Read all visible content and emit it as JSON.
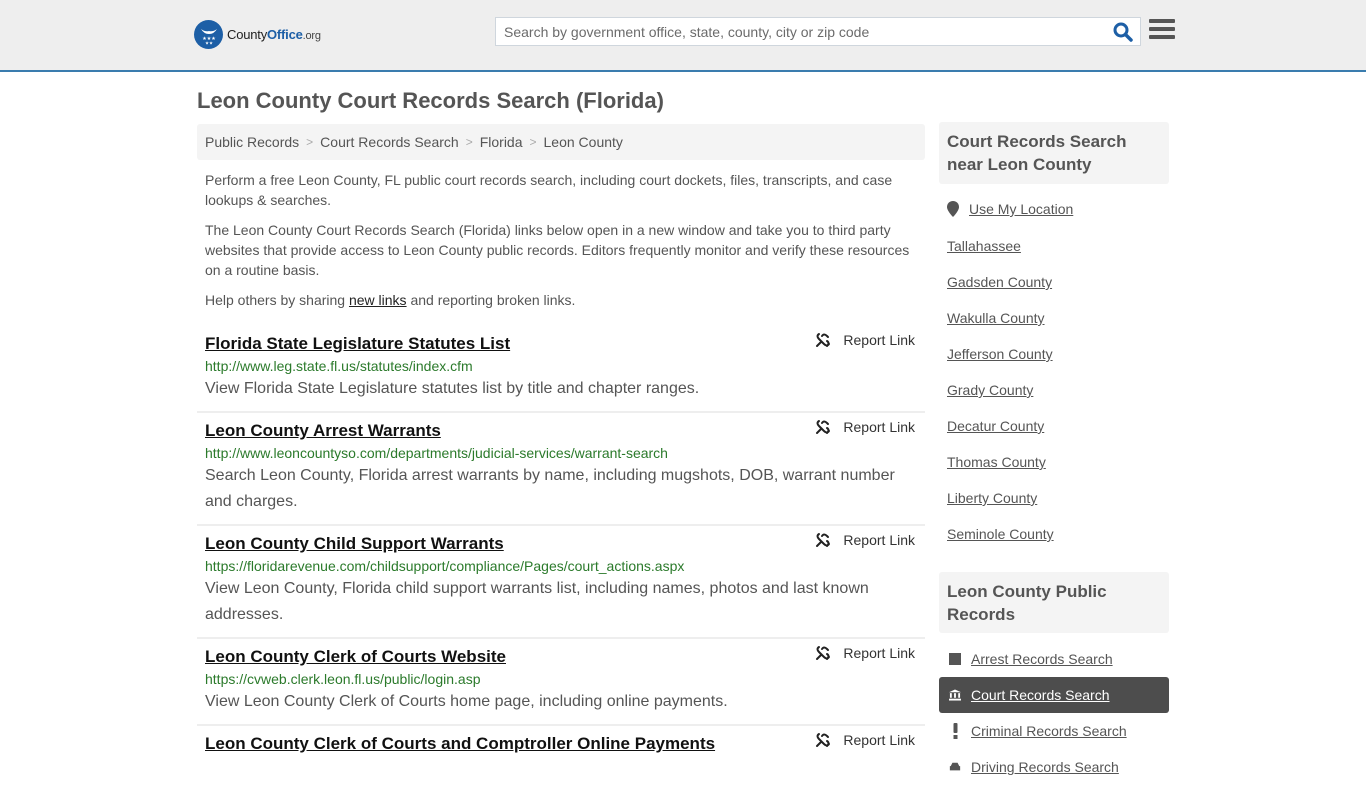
{
  "header": {
    "logo": {
      "county": "County",
      "office": "Office",
      "org": ".org"
    },
    "search_placeholder": "Search by government office, state, county, city or zip code",
    "search_icon": "search-icon",
    "menu_icon": "hamburger-menu-icon",
    "accent_color": "#1d5fa6",
    "border_color": "#3a7cae"
  },
  "page_title": "Leon County Court Records Search (Florida)",
  "breadcrumb": [
    {
      "label": "Public Records"
    },
    {
      "label": "Court Records Search"
    },
    {
      "label": "Florida"
    },
    {
      "label": "Leon County"
    }
  ],
  "intro": {
    "p1": "Perform a free Leon County, FL public court records search, including court dockets, files, transcripts, and case lookups & searches.",
    "p2": "The Leon County Court Records Search (Florida) links below open in a new window and take you to third party websites that provide access to Leon County public records. Editors frequently monitor and verify these resources on a routine basis.",
    "p3_before": "Help others by sharing ",
    "p3_link": "new links",
    "p3_after": " and reporting broken links."
  },
  "report_label": "Report Link",
  "results": [
    {
      "title": "Florida State Legislature Statutes List",
      "url": "http://www.leg.state.fl.us/statutes/index.cfm",
      "desc": "View Florida State Legislature statutes list by title and chapter ranges."
    },
    {
      "title": "Leon County Arrest Warrants",
      "url": "http://www.leoncountyso.com/departments/judicial-services/warrant-search",
      "desc": "Search Leon County, Florida arrest warrants by name, including mugshots, DOB, warrant number and charges."
    },
    {
      "title": "Leon County Child Support Warrants",
      "url": "https://floridarevenue.com/childsupport/compliance/Pages/court_actions.aspx",
      "desc": "View Leon County, Florida child support warrants list, including names, photos and last known addresses."
    },
    {
      "title": "Leon County Clerk of Courts Website",
      "url": "https://cvweb.clerk.leon.fl.us/public/login.asp",
      "desc": "View Leon County Clerk of Courts home page, including online payments."
    },
    {
      "title": "Leon County Clerk of Courts and Comptroller Online Payments",
      "url": "",
      "desc": ""
    }
  ],
  "sidebar": {
    "nearby_heading": "Court Records Search near Leon County",
    "use_location": "Use My Location",
    "nearby": [
      "Tallahassee",
      "Gadsden County",
      "Wakulla County",
      "Jefferson County",
      "Grady County",
      "Decatur County",
      "Thomas County",
      "Liberty County",
      "Seminole County"
    ],
    "records_heading": "Leon County Public Records",
    "records": [
      {
        "label": "Arrest Records Search",
        "icon": "square-icon",
        "active": false
      },
      {
        "label": "Court Records Search",
        "icon": "courthouse-icon",
        "active": true
      },
      {
        "label": "Criminal Records Search",
        "icon": "exclamation-icon",
        "active": false
      },
      {
        "label": "Driving Records Search",
        "icon": "car-icon",
        "active": false
      }
    ]
  }
}
